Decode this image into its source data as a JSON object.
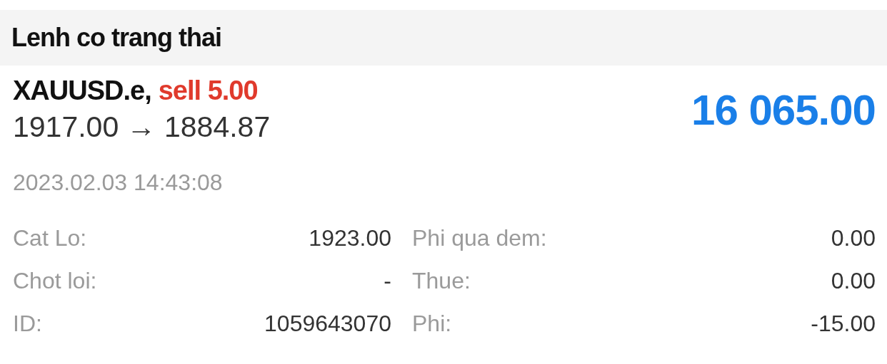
{
  "header": {
    "title": "Lenh co trang thai"
  },
  "order": {
    "symbol": "XAUUSD.e,",
    "direction": "sell",
    "volume": "5.00",
    "prices": "1917.00 → 1884.87",
    "profit": "16 065.00",
    "time": "2023.02.03 14:43:08"
  },
  "details": [
    {
      "label": "Cat Lo:",
      "value": "1923.00"
    },
    {
      "label": "Phi qua dem:",
      "value": "0.00"
    },
    {
      "label": "Chot loi:",
      "value": "-"
    },
    {
      "label": "Thue:",
      "value": "0.00"
    },
    {
      "label": "ID:",
      "value": "1059643070"
    },
    {
      "label": "Phi:",
      "value": "-15.00"
    }
  ]
}
